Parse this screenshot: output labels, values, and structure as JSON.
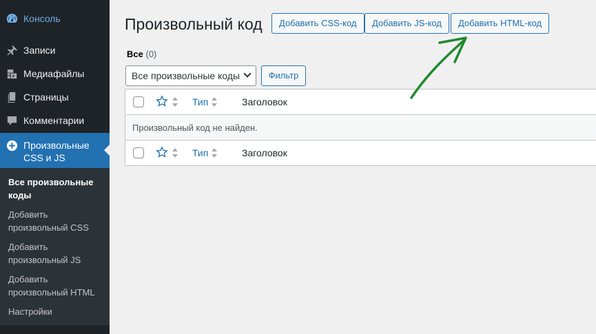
{
  "sidebar": {
    "items": [
      {
        "label": "Консоль",
        "icon": "dashboard-icon"
      },
      {
        "label": "Записи",
        "icon": "pin-icon"
      },
      {
        "label": "Медиафайлы",
        "icon": "media-icon"
      },
      {
        "label": "Страницы",
        "icon": "pages-icon"
      },
      {
        "label": "Комментарии",
        "icon": "comments-icon"
      },
      {
        "label": "Произвольные CSS и JS",
        "icon": "plus-circle-icon"
      }
    ],
    "submenu": [
      "Все произвольные коды",
      "Добавить произвольный CSS",
      "Добавить произвольный JS",
      "Добавить произвольный HTML",
      "Настройки"
    ]
  },
  "header": {
    "title": "Произвольный код",
    "buttons": [
      "Добавить CSS-код",
      "Добавить JS-код",
      "Добавить HTML-код"
    ]
  },
  "views": {
    "label": "Все",
    "count": "(0)"
  },
  "filter": {
    "select_value": "Все произвольные коды",
    "button_label": "Фильтр"
  },
  "table": {
    "columns": {
      "type": "Тип",
      "title": "Заголовок"
    },
    "empty_message": "Произвольный код не найден."
  },
  "colors": {
    "sidebar_bg": "#1d2327",
    "accent": "#2271b1",
    "annotation": "#1e8a2c"
  }
}
